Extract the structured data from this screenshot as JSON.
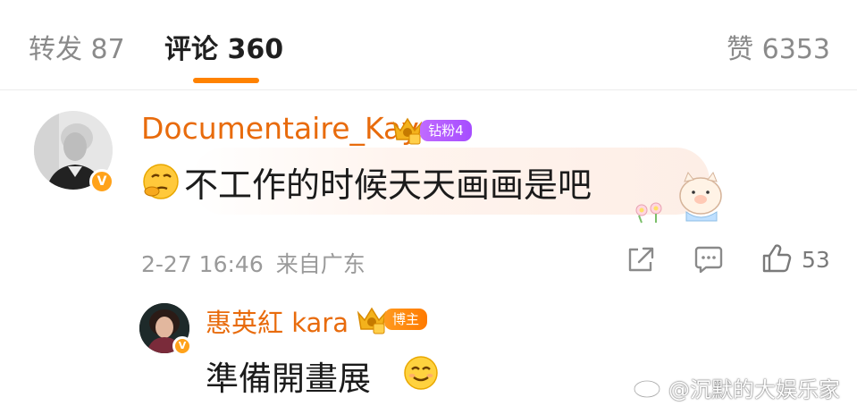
{
  "tabs": {
    "repost_label": "转发 87",
    "comment_label": "评论 360",
    "like_label": "赞 6353"
  },
  "comment": {
    "username": "Documentaire_Kay",
    "fan_badge": "钻粉4",
    "text": "不工作的时候天天画画是吧",
    "time": "2-27 16:46",
    "location": "来自广东",
    "like_count": "53",
    "verified": "V",
    "accent_color": "#e86b0c"
  },
  "reply": {
    "username": "惠英紅 kara",
    "role_badge": "博主",
    "text": "準備開畫展",
    "verified": "V"
  },
  "watermark": "@沉默的大娱乐家",
  "colors": {
    "tab_active_underline": "#ff8200",
    "username": "#e86b0c",
    "fan_badge_bg": "#b05cff",
    "role_badge_bg": "#ff8200"
  }
}
